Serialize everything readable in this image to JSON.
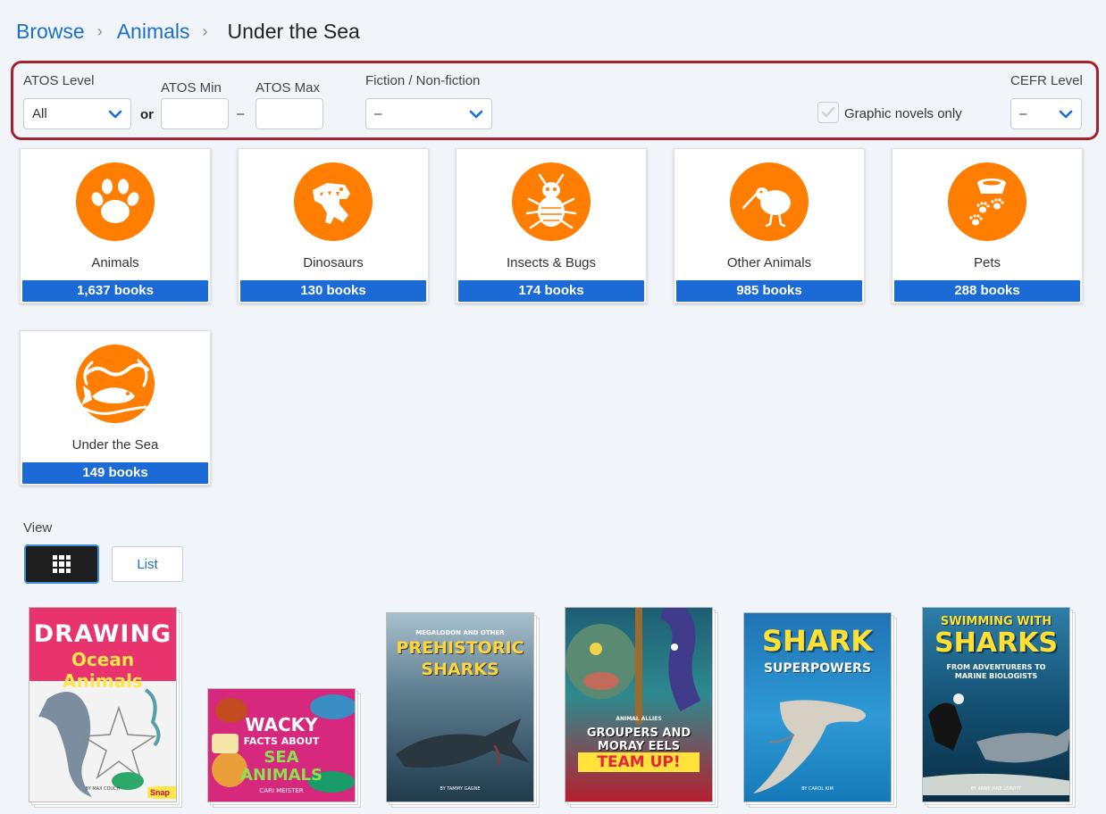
{
  "breadcrumb": {
    "items": [
      "Browse",
      "Animals"
    ],
    "current": "Under the Sea"
  },
  "filters": {
    "atos_level_label": "ATOS Level",
    "atos_level_value": "All",
    "or_label": "or",
    "atos_min_label": "ATOS Min",
    "atos_max_label": "ATOS Max",
    "range_dash": "–",
    "fiction_label": "Fiction / Non-fiction",
    "fiction_value": "–",
    "graphic_novels_label": "Graphic novels only",
    "cefr_label": "CEFR Level",
    "cefr_value": "–"
  },
  "categories": [
    {
      "name": "Animals",
      "count": "1,637 books",
      "icon": "paw-icon"
    },
    {
      "name": "Dinosaurs",
      "count": "130 books",
      "icon": "dinosaur-icon"
    },
    {
      "name": "Insects & Bugs",
      "count": "174 books",
      "icon": "bug-icon"
    },
    {
      "name": "Other Animals",
      "count": "985 books",
      "icon": "kiwi-bird-icon"
    },
    {
      "name": "Pets",
      "count": "288 books",
      "icon": "pet-bowl-icon"
    },
    {
      "name": "Under the Sea",
      "count": "149 books",
      "icon": "fish-icon"
    }
  ],
  "view": {
    "label": "View",
    "list_label": "List",
    "active": "grid"
  },
  "books": [
    {
      "title_line1": "DRAWING",
      "title_line2": "Ocean Animals",
      "author": "BY MAX COUCH",
      "publisher": "Snap"
    },
    {
      "title_line1": "WACKY",
      "title_line2": "FACTS ABOUT",
      "title_line3": "SEA",
      "title_line4": "ANIMALS",
      "author": "CARI MEISTER"
    },
    {
      "subtitle": "MEGALODON AND OTHER",
      "title_line1": "PREHISTORIC",
      "title_line2": "SHARKS",
      "author": "BY TAMMY GAGNE"
    },
    {
      "subtitle": "ANIMAL ALLIES",
      "title_line1": "GROUPERS AND",
      "title_line2": "MORAY EELS",
      "title_line3": "TEAM UP!"
    },
    {
      "title_line1": "SHARK",
      "title_line2": "SUPERPOWERS",
      "author": "BY CAROL KIM"
    },
    {
      "title_line1": "SWIMMING WITH",
      "title_line2": "SHARKS",
      "subtitle": "FROM ADVENTURERS TO MARINE BIOLOGISTS",
      "author": "BY ANNE JANE LEAVITT"
    }
  ],
  "colors": {
    "link": "#1d6fcf",
    "accent_orange": "#ff7e00",
    "count_bar": "#1c6ad6",
    "filter_border": "#a4202b"
  }
}
